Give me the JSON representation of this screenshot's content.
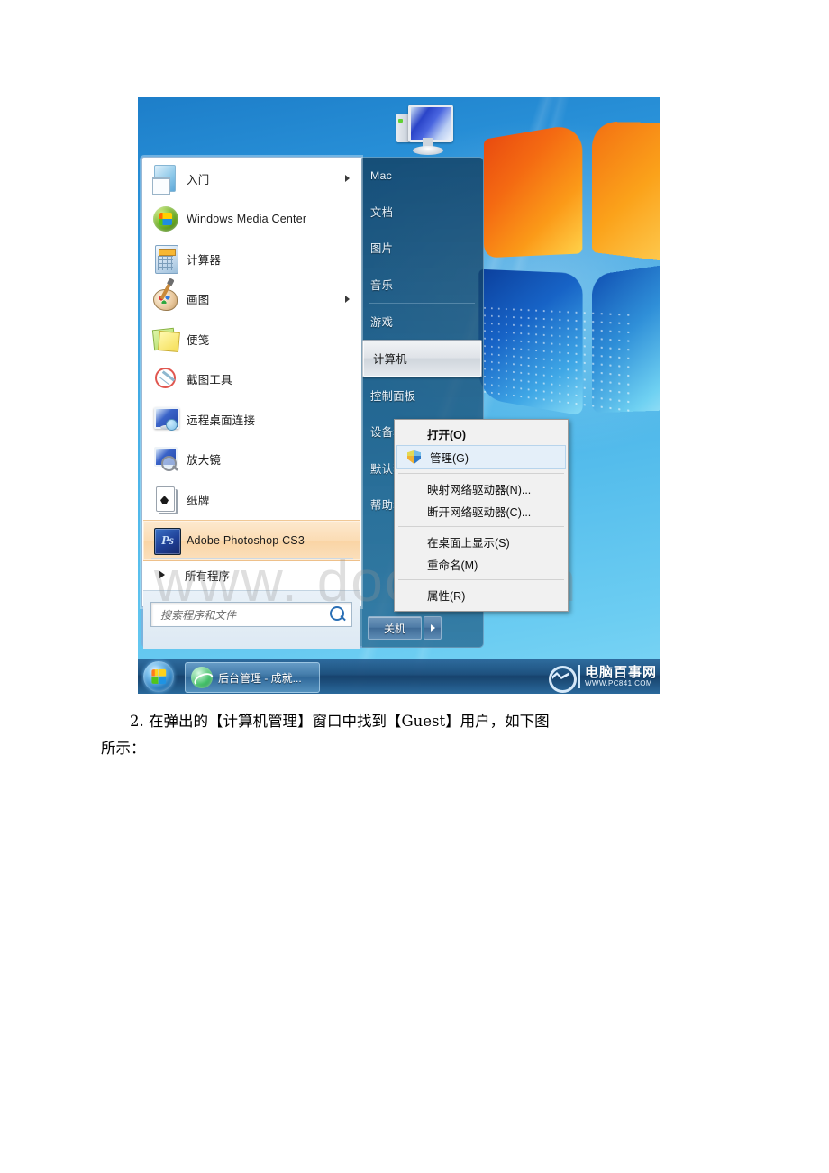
{
  "screenshot": {
    "start_menu": {
      "left_items": [
        {
          "label": "入门",
          "icon": "getting-started-icon",
          "has_submenu": true
        },
        {
          "label": "Windows Media Center",
          "icon": "windows-media-center-icon",
          "has_submenu": false
        },
        {
          "label": "计算器",
          "icon": "calculator-icon",
          "has_submenu": false
        },
        {
          "label": "画图",
          "icon": "paint-icon",
          "has_submenu": true
        },
        {
          "label": "便笺",
          "icon": "sticky-notes-icon",
          "has_submenu": false
        },
        {
          "label": "截图工具",
          "icon": "snipping-tool-icon",
          "has_submenu": false
        },
        {
          "label": "远程桌面连接",
          "icon": "remote-desktop-icon",
          "has_submenu": false
        },
        {
          "label": "放大镜",
          "icon": "magnifier-icon",
          "has_submenu": false
        },
        {
          "label": "纸牌",
          "icon": "solitaire-icon",
          "has_submenu": false
        },
        {
          "label": "Adobe Photoshop CS3",
          "icon": "photoshop-icon",
          "has_submenu": false,
          "selected": true
        }
      ],
      "photoshop_badge": "Ps",
      "all_programs": "所有程序",
      "search_placeholder": "搜索程序和文件",
      "right_items": [
        {
          "label": "Mac"
        },
        {
          "label": "文档"
        },
        {
          "label": "图片"
        },
        {
          "label": "音乐"
        },
        {
          "label": "游戏"
        },
        {
          "label": "计算机",
          "selected": true
        },
        {
          "label": "控制面板"
        },
        {
          "label": "设备和打印机"
        },
        {
          "label": "默认程序"
        },
        {
          "label": "帮助和支持"
        }
      ],
      "shutdown_label": "关机",
      "user_picture": "computer-monitor-icon"
    },
    "context_menu": {
      "items": [
        {
          "label": "打开(O)",
          "bold": true
        },
        {
          "label": "管理(G)",
          "shield": true,
          "highlighted": true
        },
        {
          "separator": true
        },
        {
          "label": "映射网络驱动器(N)..."
        },
        {
          "label": "断开网络驱动器(C)..."
        },
        {
          "separator": true
        },
        {
          "label": "在桌面上显示(S)"
        },
        {
          "label": "重命名(M)"
        },
        {
          "separator": true
        },
        {
          "label": "属性(R)"
        }
      ]
    },
    "taskbar": {
      "start_orb": "windows-start-orb",
      "buttons": [
        {
          "label": "后台管理 - 成就...",
          "icon": "internet-explorer-icon"
        }
      ],
      "brand_cn": "电脑百事网",
      "brand_en": "WWW.PC841.COM"
    },
    "watermark": "www.  docx.com"
  },
  "document": {
    "line1": "2. 在弹出的【计算机管理】窗口中找到【Guest】用户，如下图",
    "line2": "所示："
  },
  "colors": {
    "desktop_blue": "#3fa9e4",
    "menu_white": "#ffffff",
    "selection_orange": "#fbdcb4",
    "context_menu_bg": "#f1f1f1",
    "highlight_blue": "#e4eff9"
  }
}
